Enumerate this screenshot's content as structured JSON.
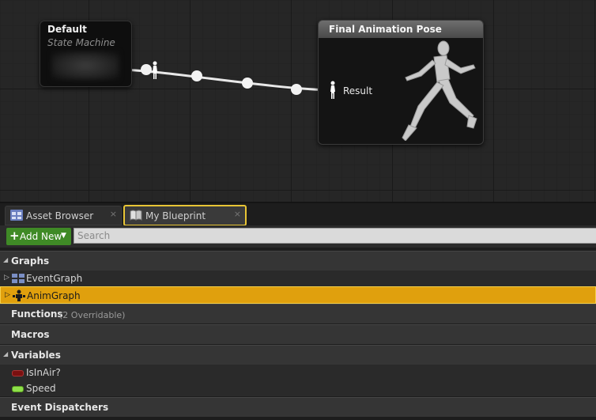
{
  "graph": {
    "state_machine_node": {
      "title": "Default",
      "subtitle": "State Machine"
    },
    "final_pose_node": {
      "title": "Final Animation Pose",
      "pin_label": "Result"
    }
  },
  "tabs": [
    {
      "label": "Asset Browser",
      "icon": "asset-browser-icon",
      "close": "×"
    },
    {
      "label": "My Blueprint",
      "icon": "blueprint-book-icon",
      "close": "×"
    }
  ],
  "toolbar": {
    "add_new_label": "Add New",
    "search_placeholder": "Search"
  },
  "tree": {
    "graphs": {
      "label": "Graphs",
      "items": [
        {
          "label": "EventGraph",
          "icon": "event-graph-icon"
        },
        {
          "label": "AnimGraph",
          "icon": "anim-graph-icon"
        }
      ]
    },
    "functions": {
      "label": "Functions",
      "note": "(2 Overridable)"
    },
    "macros": {
      "label": "Macros"
    },
    "variables": {
      "label": "Variables",
      "items": [
        {
          "label": "IsInAir?",
          "color": "#7a1010"
        },
        {
          "label": "Speed",
          "color": "#8ee04a"
        }
      ]
    },
    "event_dispatchers": {
      "label": "Event Dispatchers"
    }
  },
  "colors": {
    "selection": "#e0a00d",
    "add_new": "#3f8a26",
    "tab_highlight": "#e8c535"
  }
}
